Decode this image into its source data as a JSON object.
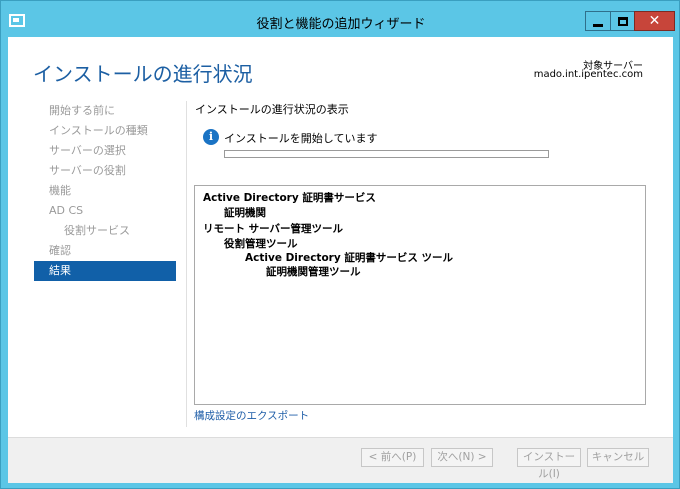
{
  "window": {
    "title": "役割と機能の追加ウィザード",
    "close_glyph": "✕"
  },
  "header": {
    "title": "インストールの進行状況",
    "target_label": "対象サーバー",
    "target_server": "mado.int.ipentec.com"
  },
  "nav": {
    "items": [
      {
        "label": "開始する前に"
      },
      {
        "label": "インストールの種類"
      },
      {
        "label": "サーバーの選択"
      },
      {
        "label": "サーバーの役割"
      },
      {
        "label": "機能"
      },
      {
        "label": "AD CS"
      },
      {
        "label": "役割サービス"
      },
      {
        "label": "確認"
      },
      {
        "label": "結果"
      }
    ]
  },
  "content": {
    "heading": "インストールの進行状況の表示",
    "info_glyph": "i",
    "status": "インストールを開始しています",
    "progress": 0,
    "results": [
      "Active Directory 証明書サービス",
      "証明機関",
      "リモート サーバー管理ツール",
      "役割管理ツール",
      "Active Directory 証明書サービス ツール",
      "証明機関管理ツール"
    ],
    "export_link": "構成設定のエクスポート"
  },
  "footer": {
    "prev": "< 前へ(P)",
    "next": "次へ(N) >",
    "install": "インストール(I)",
    "cancel": "キャンセル"
  }
}
